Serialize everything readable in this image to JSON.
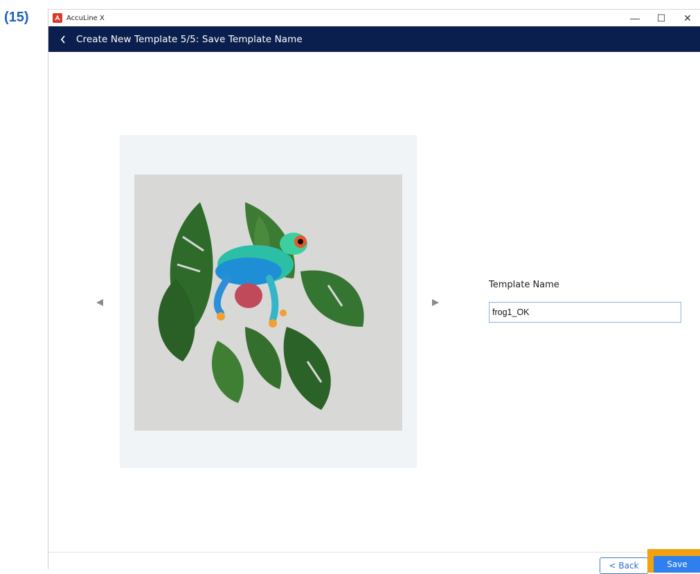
{
  "step_label": "(15)",
  "window": {
    "app_title": "AccuLine X",
    "controls": {
      "minimize": "—",
      "maximize": "☐",
      "close": "✕"
    }
  },
  "header": {
    "title": "Create New Template 5/5: Save Template Name"
  },
  "form": {
    "label": "Template Name",
    "value": "frog1_OK"
  },
  "footer": {
    "back_label": "< Back",
    "save_label": "Save"
  },
  "colors": {
    "header_bg": "#0b1f4e",
    "accent": "#2f80ee",
    "highlight": "#f2a20f",
    "step_label": "#1f5fbf"
  },
  "icons": {
    "app": "app-logo-icon",
    "back": "chevron-left-icon",
    "prev": "triangle-left-icon",
    "next": "triangle-right-icon"
  }
}
